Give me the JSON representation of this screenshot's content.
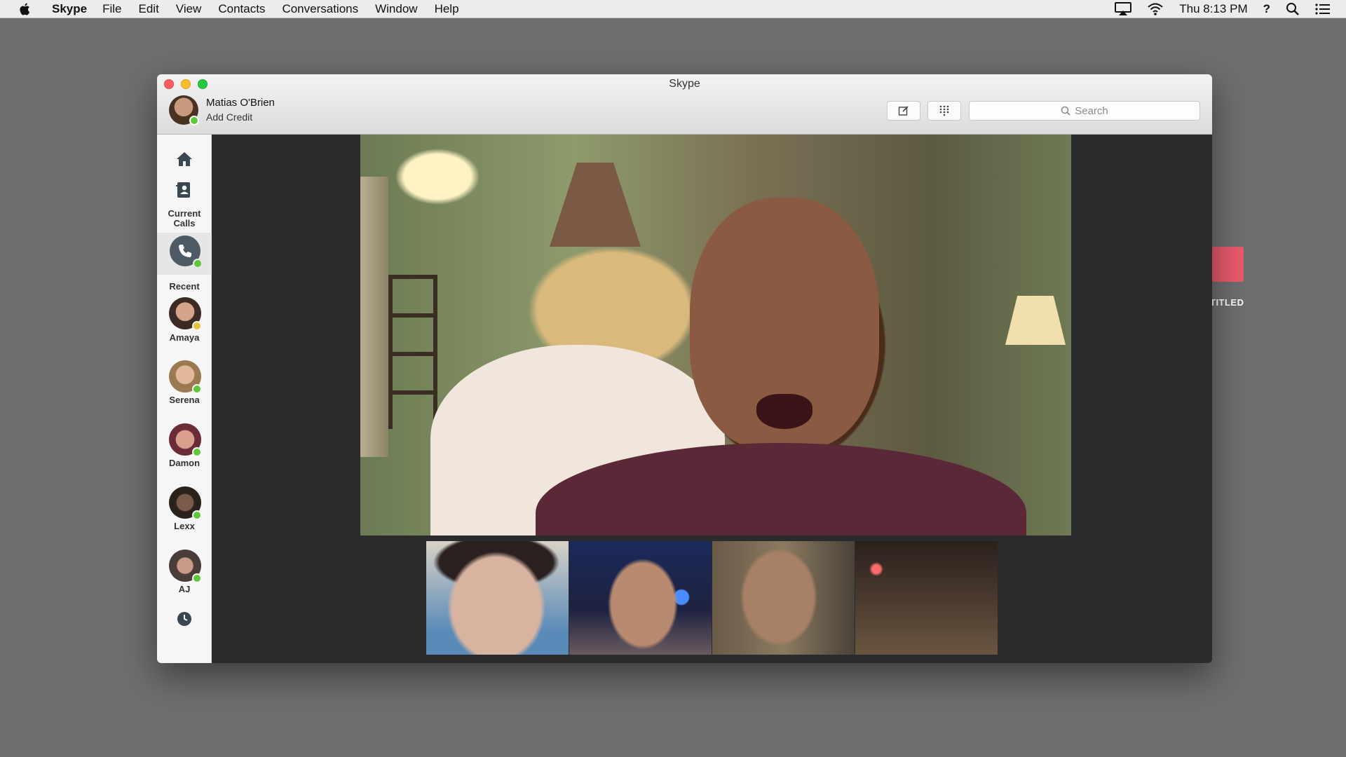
{
  "menubar": {
    "apple_icon": "apple-logo-icon",
    "items": [
      "Skype",
      "File",
      "Edit",
      "View",
      "Contacts",
      "Conversations",
      "Window",
      "Help"
    ],
    "clock": "Thu 8:13 PM",
    "status_icons": [
      "airplay-icon",
      "wifi-icon",
      "help-icon",
      "spotlight-search-icon",
      "notification-list-icon"
    ]
  },
  "desktop": {
    "item_label": "TITLED",
    "item_color": "#e85a6a"
  },
  "window": {
    "title": "Skype",
    "profile": {
      "name": "Matias O'Brien",
      "subtitle": "Add Credit",
      "status": "online"
    },
    "toolbar": {
      "compose_icon": "compose-icon",
      "dialpad_icon": "dialpad-icon",
      "search_placeholder": "Search"
    },
    "sidebar": {
      "current_calls_label": "Current Calls",
      "recent_label": "Recent",
      "contacts": [
        {
          "name": "Amaya",
          "status": "away"
        },
        {
          "name": "Serena",
          "status": "online"
        },
        {
          "name": "Damon",
          "status": "online"
        },
        {
          "name": "Lexx",
          "status": "online"
        },
        {
          "name": "AJ",
          "status": "online"
        }
      ]
    },
    "call": {
      "participants_in_strip": 4
    }
  },
  "colors": {
    "online": "#5cc83a",
    "away": "#e4c53a",
    "desktop_bg": "#6e6e70"
  }
}
